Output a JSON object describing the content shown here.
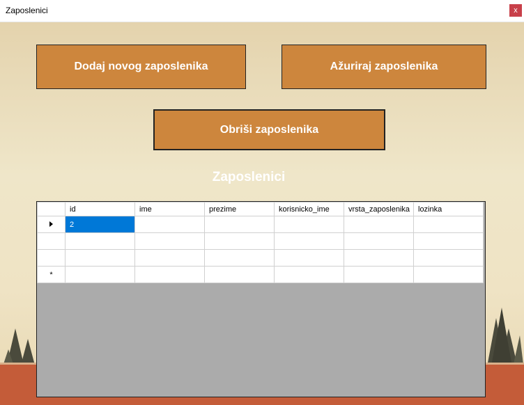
{
  "window": {
    "title": "Zaposlenici",
    "close_label": "x"
  },
  "buttons": {
    "add": "Dodaj novog zaposlenika",
    "update": "Ažuriraj zaposlenika",
    "delete": "Obriši zaposlenika"
  },
  "section_title": "Zaposlenici",
  "grid": {
    "columns": [
      "id",
      "ime",
      "prezime",
      "korisnicko_ime",
      "vrsta_zaposlenika",
      "lozinka"
    ],
    "rows": [
      [
        "2",
        "",
        "",
        "",
        "",
        ""
      ],
      [
        "",
        "",
        "",
        "",
        "",
        ""
      ],
      [
        "",
        "",
        "",
        "",
        "",
        ""
      ],
      [
        "",
        "",
        "",
        "",
        "",
        ""
      ]
    ],
    "new_row_marker": "*"
  },
  "colors": {
    "button": "#cd863d",
    "selection": "#0078d7",
    "grid_background": "#ababab",
    "ground": "#c45c39"
  }
}
